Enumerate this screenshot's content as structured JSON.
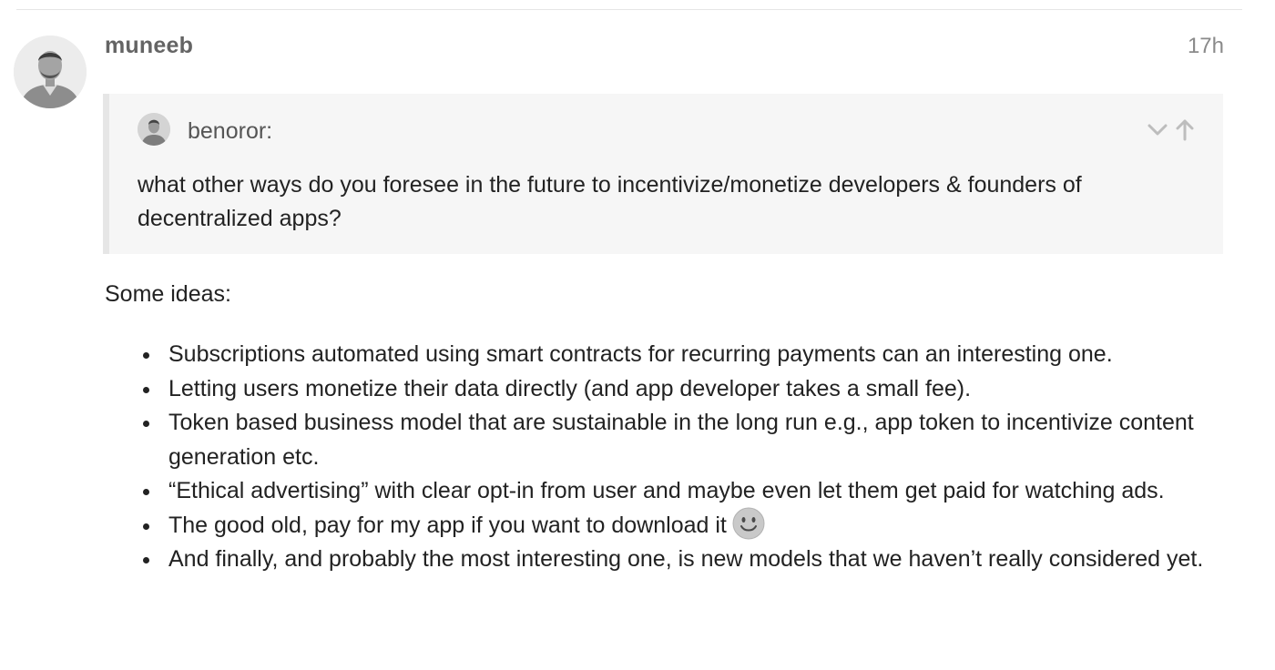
{
  "post": {
    "username": "muneeb",
    "date": "17h",
    "quote": {
      "username": "benoror:",
      "text": "what other ways do you foresee in the future to incentivize/monetize developers & founders of decentralized apps?",
      "icons": [
        "chevron-down-icon",
        "arrow-up-icon"
      ]
    },
    "lead": "Some ideas:",
    "ideas": [
      "Subscriptions automated using smart contracts for recurring payments can an interesting one.",
      "Letting users monetize their data directly (and app developer takes a small fee).",
      "Token based business model that are sustainable in the long run e.g., app token to incentivize content generation etc.",
      "“Ethical advertising” with clear opt-in from user and maybe even let them get paid for watching ads.",
      "The good old, pay for my app if you want to download it",
      "And finally, and probably the most interesting one, is new models that we haven’t really considered yet."
    ],
    "emoji": "slightly-smiling-face-icon"
  }
}
